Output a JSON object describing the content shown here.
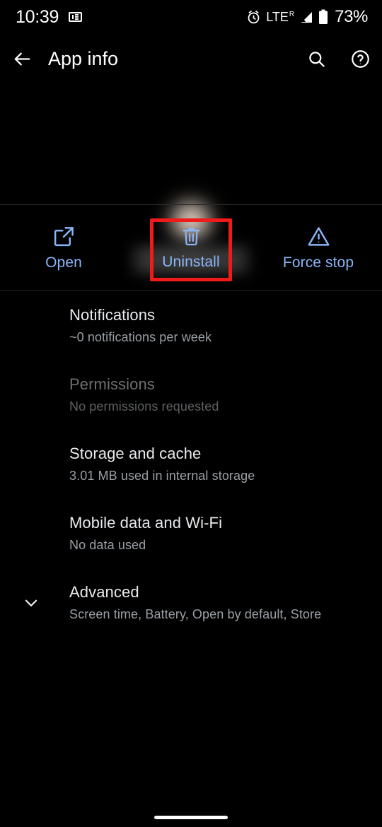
{
  "status_bar": {
    "time": "10:39",
    "notification_icon": "news-card-icon",
    "alarm_icon": "alarm-clock-icon",
    "network_type": "LTE",
    "roaming_indicator": "R",
    "signal_icon": "signal-bars-icon",
    "battery_icon": "battery-icon",
    "battery_percent": "73%"
  },
  "app_bar": {
    "back_icon": "arrow-back-icon",
    "title": "App info",
    "search_icon": "search-icon",
    "help_icon": "help-circle-icon"
  },
  "app_header": {
    "app_icon": "blurred-app-icon",
    "app_name": "blurred-app-name"
  },
  "actions": [
    {
      "label": "Open",
      "icon": "open-in-new-icon",
      "highlighted": false
    },
    {
      "label": "Uninstall",
      "icon": "trash-icon",
      "highlighted": true
    },
    {
      "label": "Force stop",
      "icon": "warning-triangle-icon",
      "highlighted": false
    }
  ],
  "highlight_color": "#f11a1a",
  "accent_color": "#8ab4f8",
  "settings": [
    {
      "title": "Notifications",
      "subtitle": "~0 notifications per week",
      "disabled": false,
      "chevron": false
    },
    {
      "title": "Permissions",
      "subtitle": "No permissions requested",
      "disabled": true,
      "chevron": false
    },
    {
      "title": "Storage and cache",
      "subtitle": "3.01 MB used in internal storage",
      "disabled": false,
      "chevron": false
    },
    {
      "title": "Mobile data and Wi-Fi",
      "subtitle": "No data used",
      "disabled": false,
      "chevron": false
    },
    {
      "title": "Advanced",
      "subtitle": "Screen time, Battery, Open by default, Store",
      "disabled": false,
      "chevron": true,
      "chevron_icon": "chevron-down-icon"
    }
  ],
  "nav_bar": {
    "pill": "gesture-nav-pill"
  }
}
